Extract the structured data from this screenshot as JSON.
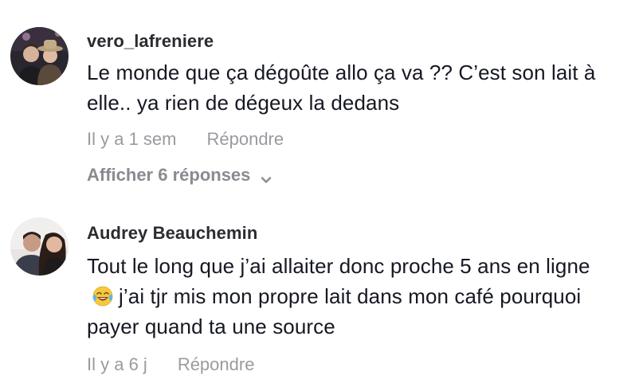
{
  "comments": [
    {
      "username": "vero_lafreniere",
      "text": "Le monde que ça dégoûte allo ça va ?? C’est son lait à elle.. ya rien de dégeux la dedans",
      "time": "Il y a 1 sem",
      "reply_label": "Répondre",
      "replies_label": "Afficher 6 réponses"
    },
    {
      "username": "Audrey Beauchemin",
      "text_before_emoji": "Tout le long que j’ai allaiter donc proche 5 ans en ligne",
      "emoji": "face-with-tears-of-joy",
      "text_after_emoji": "j’ai tjr mis mon propre lait dans mon café pourquoi payer quand ta une source",
      "time": "Il y a 6 j",
      "reply_label": "Répondre"
    }
  ],
  "colors": {
    "text": "#161823",
    "username": "#2b2b30",
    "secondary": "#9a9aa0",
    "replies_toggle": "#8a8b91",
    "background": "#ffffff"
  }
}
